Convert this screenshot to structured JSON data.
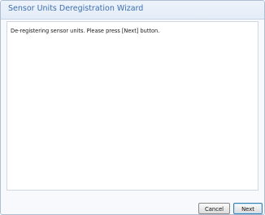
{
  "window": {
    "title": "Sensor Units Deregistration Wizard"
  },
  "main": {
    "message": "De-registering sensor units. Please press [Next] button."
  },
  "footer": {
    "cancel_label": "Cancel",
    "next_label": "Next"
  }
}
